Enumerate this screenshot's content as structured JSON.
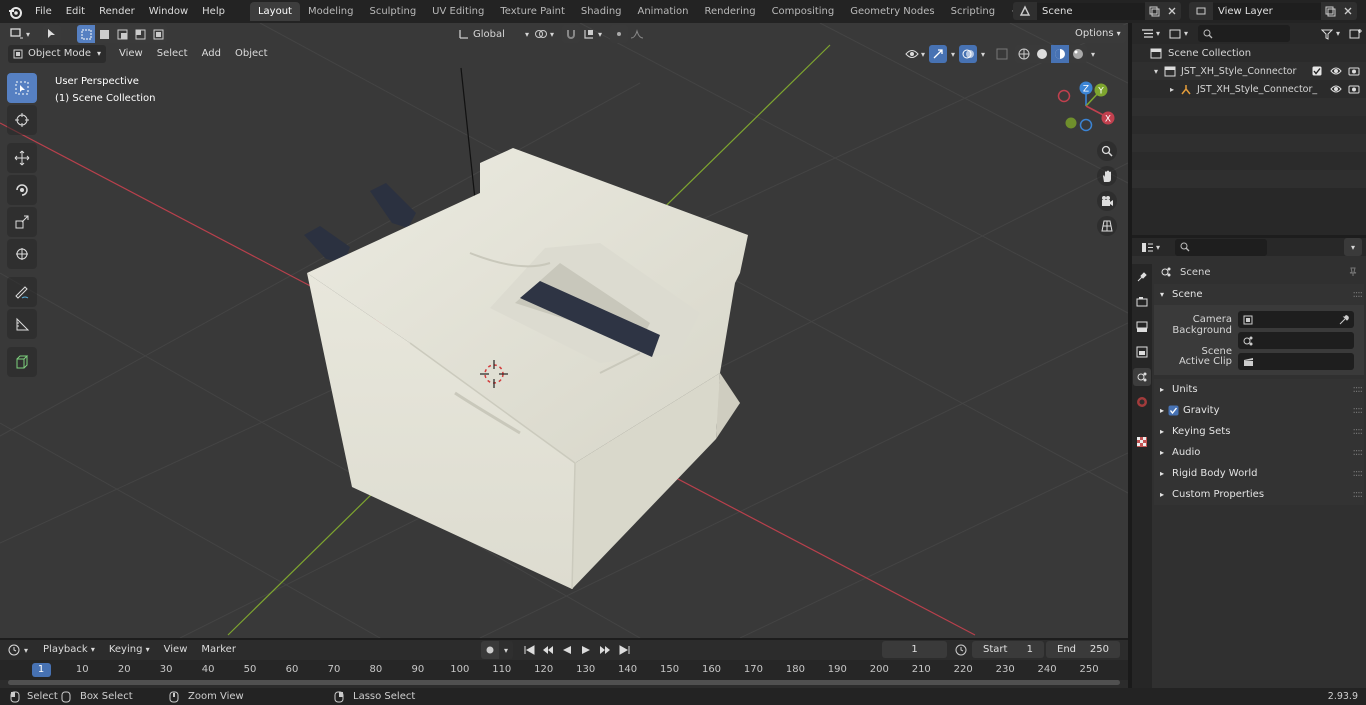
{
  "topbar": {
    "menu": [
      "File",
      "Edit",
      "Render",
      "Window",
      "Help"
    ],
    "workspaces": [
      "Layout",
      "Modeling",
      "Sculpting",
      "UV Editing",
      "Texture Paint",
      "Shading",
      "Animation",
      "Rendering",
      "Compositing",
      "Geometry Nodes",
      "Scripting"
    ],
    "active_workspace": "Layout",
    "add_tab": "+",
    "scene": "Scene",
    "view_layer": "View Layer"
  },
  "viewport": {
    "mode": "Object Mode",
    "menu": [
      "View",
      "Select",
      "Add",
      "Object"
    ],
    "orientation": "Global",
    "options": "Options",
    "overlay_title": "User Perspective",
    "overlay_sub": "(1) Scene Collection",
    "gizmo": {
      "z": "Z",
      "y": "Y",
      "x": "X"
    }
  },
  "outliner": {
    "collection": "Scene Collection",
    "items": [
      "JST_XH_Style_Connector",
      "JST_XH_Style_Connector_"
    ]
  },
  "properties": {
    "header": "Scene",
    "panel": "Scene",
    "fields": [
      {
        "label": "Camera",
        "value": ""
      },
      {
        "label": "Background Scene",
        "value": ""
      },
      {
        "label": "Active Clip",
        "value": ""
      }
    ],
    "sections": [
      "Units",
      "Gravity",
      "Keying Sets",
      "Audio",
      "Rigid Body World",
      "Custom Properties"
    ]
  },
  "timeline": {
    "menu": [
      "Playback",
      "Keying",
      "View",
      "Marker"
    ],
    "current_frame": "1",
    "start_label": "Start",
    "start": "1",
    "end_label": "End",
    "end": "250",
    "ticks": [
      "1",
      "10",
      "20",
      "30",
      "40",
      "50",
      "60",
      "70",
      "80",
      "90",
      "100",
      "110",
      "120",
      "130",
      "140",
      "150",
      "160",
      "170",
      "180",
      "190",
      "200",
      "210",
      "220",
      "230",
      "240",
      "250"
    ]
  },
  "statusbar": {
    "items": [
      "Select",
      "Box Select",
      "Zoom View",
      "Lasso Select"
    ],
    "version": "2.93.9"
  },
  "colors": {
    "accent": "#4772b3",
    "x_axis": "#c1404e",
    "y_axis": "#7ea52f",
    "z_axis": "#3b84d4"
  }
}
